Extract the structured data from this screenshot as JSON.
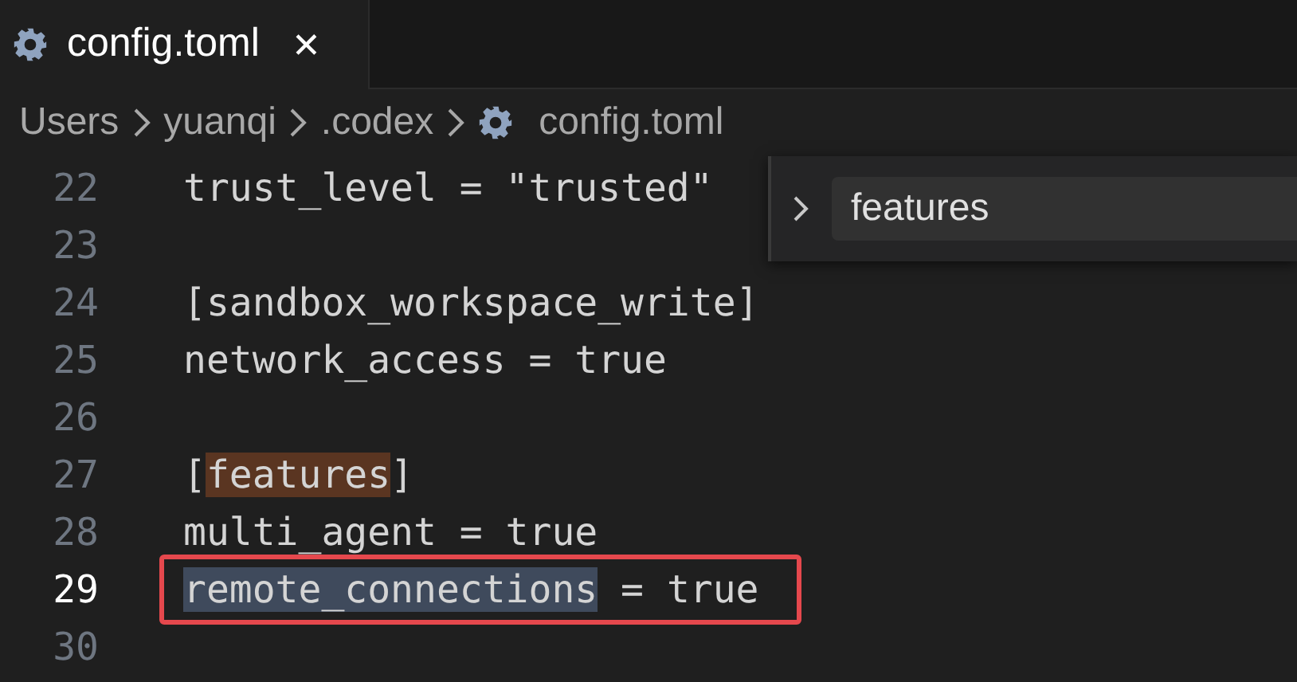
{
  "tab": {
    "title": "config.toml",
    "close": "✕"
  },
  "breadcrumb": [
    {
      "label": "Users",
      "kind": "folder"
    },
    {
      "label": "yuanqi",
      "kind": "folder"
    },
    {
      "label": ".codex",
      "kind": "folder"
    },
    {
      "label": "config.toml",
      "kind": "file"
    }
  ],
  "find_widget": {
    "expanded": false,
    "value": "features"
  },
  "lines": [
    {
      "number": "22",
      "current": false,
      "outlined": false,
      "segments": [
        {
          "text": "trust_level = \"trusted\"",
          "kind": "plain"
        }
      ]
    },
    {
      "number": "23",
      "current": false,
      "outlined": false
    },
    {
      "number": "24",
      "current": false,
      "outlined": false,
      "segments": [
        {
          "text": "[sandbox_workspace_write]",
          "kind": "plain"
        }
      ]
    },
    {
      "number": "25",
      "current": false,
      "outlined": false,
      "segments": [
        {
          "text": "network_access = true",
          "kind": "plain"
        }
      ]
    },
    {
      "number": "26",
      "current": false,
      "outlined": false
    },
    {
      "number": "27",
      "current": false,
      "outlined": false,
      "segments": [
        {
          "text": "[",
          "kind": "plain"
        },
        {
          "text": "features",
          "kind": "find_match"
        },
        {
          "text": "]",
          "kind": "plain"
        }
      ]
    },
    {
      "number": "28",
      "current": false,
      "outlined": false,
      "segments": [
        {
          "text": "multi_agent = true",
          "kind": "plain"
        }
      ]
    },
    {
      "number": "29",
      "current": true,
      "outlined": true,
      "segments": [
        {
          "text": "remote_connections",
          "kind": "selection"
        },
        {
          "text": " = true",
          "kind": "plain"
        }
      ]
    },
    {
      "number": "30",
      "current": false,
      "outlined": false
    }
  ]
}
